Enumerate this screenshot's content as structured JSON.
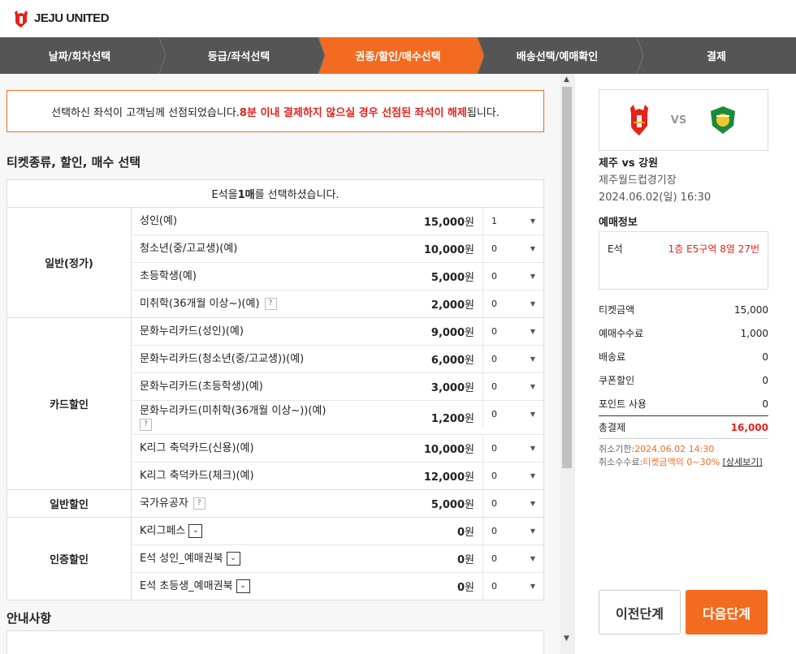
{
  "brand": {
    "name": "JEJU UNITED"
  },
  "steps": [
    {
      "label": "날짜/회차선택",
      "active": false
    },
    {
      "label": "등급/좌석선택",
      "active": false
    },
    {
      "label": "권종/할인/매수선택",
      "active": true
    },
    {
      "label": "배송선택/예매확인",
      "active": false
    },
    {
      "label": "결제",
      "active": false
    }
  ],
  "notice": {
    "pre": "선택하신 좌석이 고객님께 선점되었습니다. ",
    "warn": "8분 이내 결제하지 않으실 경우 선점된 좌석이 해제",
    "post": "됩니다."
  },
  "section_title": "티켓종류, 할인, 매수 선택",
  "table_header": {
    "pre": "E석을 ",
    "bold": "1매",
    "post": "를 선택하셨습니다."
  },
  "groups": [
    {
      "name": "일반(정가)",
      "rows": [
        {
          "name": "성인(예)",
          "price": "15,000",
          "qty": "1"
        },
        {
          "name": "청소년(중/고교생)(예)",
          "price": "10,000",
          "qty": "0"
        },
        {
          "name": "초등학생(예)",
          "price": "5,000",
          "qty": "0"
        },
        {
          "name": "미취학(36개월 이상~)(예)",
          "price": "2,000",
          "qty": "0",
          "help": "?"
        }
      ]
    },
    {
      "name": "카드할인",
      "rows": [
        {
          "name": "문화누리카드(성인)(예)",
          "price": "9,000",
          "qty": "0"
        },
        {
          "name": "문화누리카드(청소년(중/고교생))(예)",
          "price": "6,000",
          "qty": "0"
        },
        {
          "name": "문화누리카드(초등학생)(예)",
          "price": "3,000",
          "qty": "0"
        },
        {
          "name": "문화누리카드(미취학(36개월 이상~))(예)",
          "price": "1,200",
          "qty": "0",
          "help": "?"
        },
        {
          "name": "K리그 축덕카드(신용)(예)",
          "price": "10,000",
          "qty": "0"
        },
        {
          "name": "K리그 축덕카드(체크)(예)",
          "price": "12,000",
          "qty": "0"
        }
      ]
    },
    {
      "name": "일반할인",
      "rows": [
        {
          "name": "국가유공자",
          "price": "5,000",
          "qty": "0",
          "help": "?"
        }
      ]
    },
    {
      "name": "인증할인",
      "rows": [
        {
          "name": "K리그페스",
          "price": "0",
          "qty": "0",
          "dropdown": true
        },
        {
          "name": "E석 성인_예매권북",
          "price": "0",
          "qty": "0",
          "dropdown": true
        },
        {
          "name": "E석 초등생_예매권북",
          "price": "0",
          "qty": "0",
          "dropdown": true
        }
      ]
    }
  ],
  "currency": "원",
  "guide_title": "안내사항",
  "match": {
    "vs": "VS",
    "title": "제주 vs 강원",
    "venue": "제주월드컵경기장",
    "datetime": "2024.06.02(일) 16:30"
  },
  "reservation": {
    "title": "예매정보",
    "grade": "E석",
    "seat": "1층 E5구역 8열 27번"
  },
  "summary": [
    {
      "label": "티켓금액",
      "value": "15,000"
    },
    {
      "label": "예매수수료",
      "value": "1,000"
    },
    {
      "label": "배송료",
      "value": "0"
    },
    {
      "label": "쿠폰할인",
      "value": "0"
    },
    {
      "label": "포인트 사용",
      "value": "0"
    }
  ],
  "total": {
    "label": "총결제",
    "value": "16,000"
  },
  "cancel": {
    "deadline_label": "취소기한:",
    "deadline": "2024.06.02 14:30",
    "fee_label": "취소수수료:",
    "fee": "티켓금액의 0~30%",
    "detail_link": "[상세보기]"
  },
  "buttons": {
    "prev": "이전단계",
    "next": "다음단계"
  },
  "colors": {
    "accent": "#f26b21",
    "warn": "#e4231b",
    "step_bg": "#555555"
  }
}
